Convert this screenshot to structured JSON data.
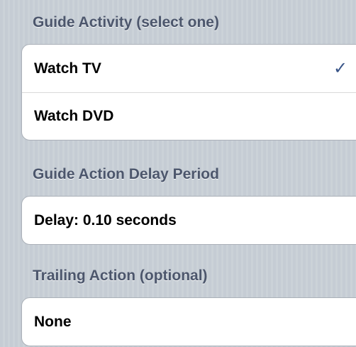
{
  "guide_activity": {
    "header": "Guide Activity (select one)",
    "options": [
      {
        "label": "Watch TV",
        "selected": true
      },
      {
        "label": "Watch DVD",
        "selected": false
      }
    ],
    "checkmark": "✓"
  },
  "guide_delay": {
    "header": "Guide Action Delay Period",
    "value": "Delay: 0.10 seconds"
  },
  "trailing_action": {
    "header": "Trailing Action (optional)",
    "value": "None"
  },
  "colors": {
    "background": "#c5ccd4",
    "header_text": "#4c566c",
    "checkmark": "#385487"
  },
  "icons": {
    "selected": "checkmark-icon"
  }
}
